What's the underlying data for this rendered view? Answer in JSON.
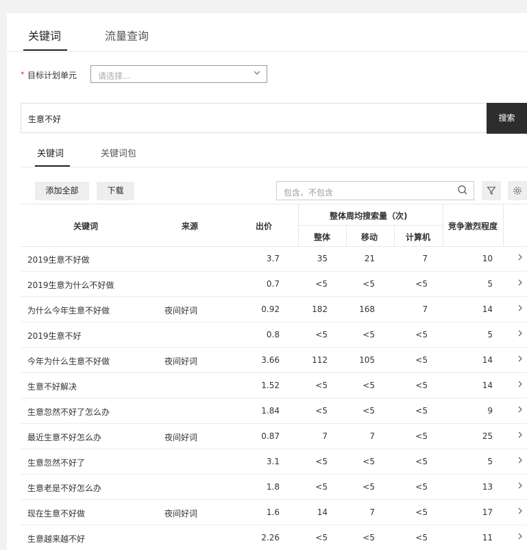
{
  "top_tabs": [
    "关键词",
    "流量查询"
  ],
  "plan_unit": {
    "required_mark": "*",
    "label": "目标计划单元",
    "placeholder": "请选择..."
  },
  "search": {
    "value": "生意不好",
    "button": "搜索"
  },
  "sub_tabs": [
    "关键词",
    "关键词包"
  ],
  "toolbar": {
    "add_all": "添加全部",
    "download": "下载",
    "filter_placeholder": "包含、不包含"
  },
  "icons": {
    "search": "search-icon",
    "filter": "filter-icon",
    "settings": "gear-icon",
    "row_action": "chevron-right-icon",
    "dropdown": "chevron-down-icon"
  },
  "table": {
    "headers": {
      "keyword": "关键词",
      "source": "来源",
      "bid": "出价",
      "weekly_group": "整体周均搜索量（次)",
      "overall": "整体",
      "mobile": "移动",
      "pc": "计算机",
      "competition": "竞争激烈程度"
    },
    "rows": [
      {
        "keyword": "2019生意不好做",
        "source": "",
        "bid": "3.7",
        "overall": "35",
        "mobile": "21",
        "pc": "7",
        "competition": "10"
      },
      {
        "keyword": "2019生意为什么不好做",
        "source": "",
        "bid": "0.7",
        "overall": "<5",
        "mobile": "<5",
        "pc": "<5",
        "competition": "5"
      },
      {
        "keyword": "为什么今年生意不好做",
        "source": "夜间好词",
        "bid": "0.92",
        "overall": "182",
        "mobile": "168",
        "pc": "7",
        "competition": "14"
      },
      {
        "keyword": "2019生意不好",
        "source": "",
        "bid": "0.8",
        "overall": "<5",
        "mobile": "<5",
        "pc": "<5",
        "competition": "5"
      },
      {
        "keyword": "今年为什么生意不好做",
        "source": "夜间好词",
        "bid": "3.66",
        "overall": "112",
        "mobile": "105",
        "pc": "<5",
        "competition": "14"
      },
      {
        "keyword": "生意不好解决",
        "source": "",
        "bid": "1.52",
        "overall": "<5",
        "mobile": "<5",
        "pc": "<5",
        "competition": "14"
      },
      {
        "keyword": "生意忽然不好了怎么办",
        "source": "",
        "bid": "1.84",
        "overall": "<5",
        "mobile": "<5",
        "pc": "<5",
        "competition": "9"
      },
      {
        "keyword": "最近生意不好怎么办",
        "source": "夜间好词",
        "bid": "0.87",
        "overall": "7",
        "mobile": "7",
        "pc": "<5",
        "competition": "25"
      },
      {
        "keyword": "生意忽然不好了",
        "source": "",
        "bid": "3.1",
        "overall": "<5",
        "mobile": "<5",
        "pc": "<5",
        "competition": "5"
      },
      {
        "keyword": "生意老是不好怎么办",
        "source": "",
        "bid": "1.8",
        "overall": "<5",
        "mobile": "<5",
        "pc": "<5",
        "competition": "13"
      },
      {
        "keyword": "现在生意不好做",
        "source": "夜间好词",
        "bid": "1.6",
        "overall": "14",
        "mobile": "7",
        "pc": "<5",
        "competition": "17"
      },
      {
        "keyword": "生意越来越不好",
        "source": "",
        "bid": "2.26",
        "overall": "<5",
        "mobile": "<5",
        "pc": "<5",
        "competition": "11"
      }
    ]
  }
}
